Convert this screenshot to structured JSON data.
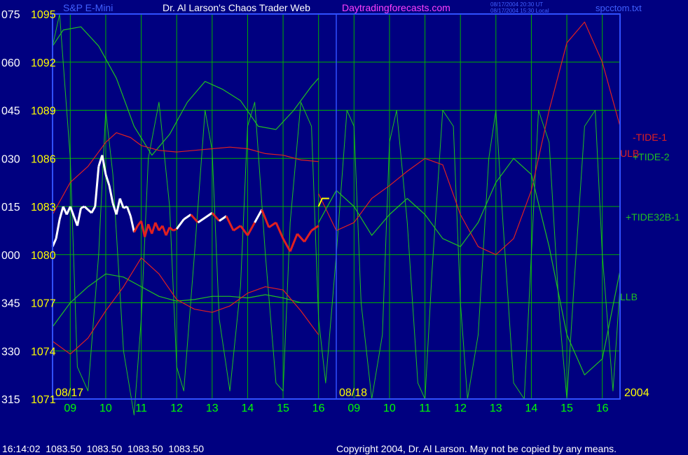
{
  "header": {
    "symbol_title": "S&P E-Mini",
    "author_title": "Dr. Al Larson's Chaos Trader Web",
    "site": "Daytradingforecasts.com",
    "timestamp_ut": "08/17/2004 20:30 UT",
    "timestamp_local": "08/17/2004 15:30 Local",
    "filename": "spcctom.txt"
  },
  "footer": {
    "status": "16:14:02  1083.50  1083.50  1083.50  1083.50",
    "copyright": "Copyright 2004, Dr. Al Larson. May not be copied by any means."
  },
  "colors": {
    "background": "#000080",
    "grid": "#00b000",
    "price_axis": "#ffff00",
    "angle_axis": "#ffffff",
    "time_axis": "#00ff00",
    "tide_red": "#e02020",
    "tide_green": "#20c020",
    "title_pink": "#ff40ff",
    "title_blue": "#4060ff"
  },
  "chart_data": {
    "type": "line",
    "y_price_ticks": [
      "1095",
      "1092",
      "1089",
      "1086",
      "1083",
      "1080",
      "1077",
      "1074",
      "1071"
    ],
    "y_angle_ticks": [
      "075",
      "060",
      "045",
      "030",
      "015",
      "000",
      "345",
      "330",
      "315"
    ],
    "x_time_ticks": [
      "09",
      "10",
      "11",
      "12",
      "13",
      "14",
      "15",
      "16",
      "09",
      "10",
      "11",
      "12",
      "13",
      "14",
      "15",
      "16"
    ],
    "date_labels": [
      "08/17",
      "08/18"
    ],
    "year_label": "2004",
    "ylim": [
      1071,
      1095
    ],
    "x_range_hours": [
      8.5,
      24.5
    ],
    "series_labels": [
      "-TIDE-1",
      "ULB",
      "+TIDE-2",
      "+TIDE32B-1",
      "LLB"
    ],
    "price": {
      "hours": [
        8.5,
        8.6,
        8.7,
        8.8,
        8.9,
        9.0,
        9.1,
        9.2,
        9.3,
        9.4,
        9.5,
        9.6,
        9.7,
        9.8,
        9.9,
        10.0,
        10.1,
        10.2,
        10.3,
        10.4,
        10.5,
        10.6,
        10.7,
        10.8,
        10.9,
        11.0,
        11.1,
        11.2,
        11.3,
        11.4,
        11.5,
        11.6,
        11.7,
        11.8,
        11.9,
        12.0,
        12.2,
        12.4,
        12.6,
        12.8,
        13.0,
        13.2,
        13.4,
        13.6,
        13.8,
        14.0,
        14.2,
        14.4,
        14.6,
        14.8,
        15.0,
        15.2,
        15.4,
        15.6,
        15.8,
        16.0
      ],
      "values": [
        1080.5,
        1081.0,
        1082.2,
        1083.0,
        1082.5,
        1083.0,
        1082.4,
        1081.8,
        1082.9,
        1083.0,
        1082.8,
        1082.6,
        1083.0,
        1085.5,
        1086.2,
        1085.0,
        1084.3,
        1083.2,
        1082.5,
        1083.5,
        1082.9,
        1083.0,
        1082.4,
        1081.4,
        1081.8,
        1082.1,
        1081.1,
        1081.9,
        1081.3,
        1082.0,
        1081.5,
        1081.8,
        1081.2,
        1081.7,
        1081.5,
        1081.6,
        1082.2,
        1082.5,
        1082.0,
        1082.3,
        1082.6,
        1082.1,
        1082.4,
        1081.5,
        1081.8,
        1081.2,
        1082.0,
        1082.8,
        1081.7,
        1082.0,
        1081.0,
        1080.2,
        1081.3,
        1080.8,
        1081.5,
        1081.8
      ]
    },
    "forecast_segment": {
      "hours": [
        16.0,
        16.1,
        16.3
      ],
      "values": [
        1083.0,
        1083.5,
        1083.5
      ]
    },
    "tide_red_upper": {
      "hours": [
        8.5,
        9.0,
        9.5,
        10.0,
        10.3,
        10.7,
        11.0,
        11.5,
        12.0,
        12.5,
        13.0,
        13.5,
        14.0,
        14.5,
        15.0,
        15.5,
        16.0
      ],
      "values": [
        1082.5,
        1084.5,
        1085.5,
        1087.0,
        1087.6,
        1087.3,
        1086.8,
        1086.5,
        1086.4,
        1086.5,
        1086.6,
        1086.7,
        1086.6,
        1086.3,
        1086.2,
        1085.9,
        1085.8
      ]
    },
    "tide_red_lower": {
      "hours": [
        8.5,
        9.0,
        9.5,
        10.0,
        10.5,
        11.0,
        11.5,
        12.0,
        12.5,
        13.0,
        13.5,
        14.0,
        14.5,
        15.0,
        15.5,
        16.0
      ],
      "values": [
        1074.6,
        1073.8,
        1074.8,
        1076.5,
        1078.0,
        1079.8,
        1078.8,
        1077.2,
        1076.6,
        1076.4,
        1076.8,
        1077.6,
        1078.0,
        1077.8,
        1076.5,
        1075.0
      ]
    },
    "tide_green_upper": {
      "hours": [
        8.5,
        8.8,
        9.3,
        9.8,
        10.3,
        10.8,
        11.3,
        11.8,
        12.3,
        12.8,
        13.3,
        13.8,
        14.3,
        14.8,
        15.3,
        15.8,
        16.0
      ],
      "values": [
        1093.0,
        1094.0,
        1094.2,
        1093.0,
        1091.0,
        1088.0,
        1086.2,
        1087.5,
        1089.5,
        1090.8,
        1090.3,
        1089.6,
        1088.0,
        1087.8,
        1089.0,
        1090.5,
        1091.0
      ]
    },
    "tide_green_lower": {
      "hours": [
        8.5,
        9.0,
        9.5,
        10.0,
        10.5,
        11.0,
        11.5,
        12.0,
        12.5,
        13.0,
        13.5,
        14.0,
        14.5,
        15.0,
        15.5,
        16.0
      ],
      "values": [
        1075.5,
        1077.0,
        1078.0,
        1078.8,
        1078.6,
        1078.0,
        1077.4,
        1077.1,
        1077.2,
        1077.4,
        1077.4,
        1077.3,
        1077.5,
        1077.3,
        1077.0,
        1077.0
      ]
    },
    "tide_red_forecast": {
      "hours": [
        16.0,
        16.5,
        17.0,
        17.5,
        18.0,
        18.5,
        19.0,
        19.5,
        20.0,
        20.5,
        21.0,
        21.5,
        22.0,
        22.5,
        23.0,
        23.5,
        24.0,
        24.5
      ],
      "values": [
        1083.8,
        1081.5,
        1082.0,
        1083.5,
        1084.3,
        1085.2,
        1086.0,
        1085.6,
        1082.5,
        1080.5,
        1080.0,
        1081.0,
        1084.0,
        1089.0,
        1093.2,
        1094.5,
        1092.0,
        1088.0
      ]
    },
    "tide_green_forecast": {
      "hours": [
        16.0,
        16.5,
        17.0,
        17.5,
        18.0,
        18.5,
        19.0,
        19.5,
        20.0,
        20.5,
        21.0,
        21.5,
        22.0,
        22.5,
        23.0,
        23.5,
        24.0,
        24.5
      ],
      "values": [
        1082.0,
        1084.0,
        1083.0,
        1081.2,
        1082.5,
        1083.5,
        1082.5,
        1081.0,
        1080.5,
        1082.0,
        1084.5,
        1086.0,
        1085.0,
        1080.5,
        1075.0,
        1072.5,
        1073.5,
        1079.0
      ]
    },
    "oscillator_green": {
      "hours": [
        8.5,
        8.7,
        9.0,
        9.2,
        9.5,
        9.8,
        10.0,
        10.2,
        10.5,
        10.8,
        11.0,
        11.2,
        11.5,
        11.8,
        12.0,
        12.2,
        12.5,
        12.8,
        13.0,
        13.2,
        13.5,
        13.8,
        14.0,
        14.2,
        14.5,
        14.8,
        15.0,
        15.2,
        15.5,
        15.8,
        16.0,
        16.2,
        16.5,
        16.8,
        17.0,
        17.2,
        17.5,
        17.8,
        18.0,
        18.2,
        18.5,
        18.8,
        19.0,
        19.2,
        19.5,
        19.8,
        20.0,
        20.2,
        20.5,
        20.8,
        21.0,
        21.2,
        21.5,
        21.8,
        22.0,
        22.2,
        22.5,
        22.8,
        23.0,
        23.2,
        23.5,
        23.8,
        24.0,
        24.3,
        24.5
      ],
      "values": [
        1093.0,
        1095.0,
        1086.0,
        1073.0,
        1071.5,
        1080.0,
        1089.0,
        1085.0,
        1074.0,
        1070.0,
        1076.0,
        1086.0,
        1089.5,
        1083.0,
        1073.0,
        1071.5,
        1080.0,
        1089.0,
        1086.5,
        1076.0,
        1071.5,
        1078.0,
        1088.0,
        1089.5,
        1080.0,
        1072.0,
        1071.5,
        1082.0,
        1089.5,
        1088.0,
        1076.0,
        1072.0,
        1080.0,
        1089.0,
        1088.0,
        1077.0,
        1071.0,
        1075.0,
        1087.0,
        1089.0,
        1082.0,
        1072.0,
        1071.0,
        1079.0,
        1089.0,
        1088.0,
        1077.0,
        1071.0,
        1075.0,
        1086.0,
        1089.0,
        1082.0,
        1072.0,
        1071.0,
        1080.0,
        1089.0,
        1087.0,
        1076.0,
        1071.0,
        1078.0,
        1088.0,
        1089.0,
        1080.0,
        1071.5,
        1078.0
      ]
    }
  }
}
